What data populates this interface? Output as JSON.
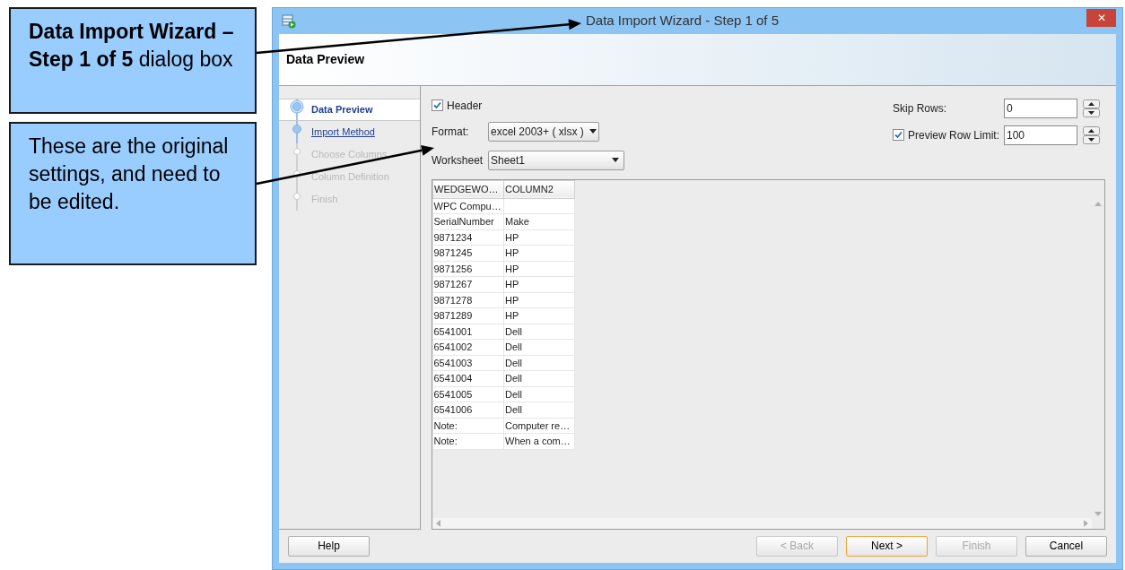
{
  "callouts": [
    {
      "text": "**Data Import Wizard – Step 1 of 5** dialog box"
    },
    {
      "text": "These are the original settings, and need to be edited."
    }
  ],
  "window": {
    "title": "Data Import Wizard - Step 1 of 5",
    "close": "✕"
  },
  "header": {
    "title": "Data Preview"
  },
  "steps": [
    {
      "label": "Data Preview",
      "kind": "current"
    },
    {
      "label": "Import Method",
      "kind": "link"
    },
    {
      "label": "Choose Columns",
      "kind": "disabled"
    },
    {
      "label": "Column Definition",
      "kind": "disabled"
    },
    {
      "label": "Finish",
      "kind": "disabled"
    }
  ],
  "header_option": {
    "label": "Header",
    "checked": true
  },
  "format": {
    "label": "Format:",
    "value": "excel 2003+ ( xlsx )"
  },
  "worksheet": {
    "label": "Worksheet",
    "value": "Sheet1"
  },
  "skip_rows": {
    "label": "Skip Rows:",
    "value": "0"
  },
  "preview_row_limit": {
    "label": "Preview Row Limit:",
    "checked": true,
    "value": "100"
  },
  "table": {
    "columns": [
      "WEDGEWO…",
      "COLUMN2"
    ],
    "rows": [
      [
        "WPC Compu…",
        ""
      ],
      [
        "SerialNumber",
        "Make"
      ],
      [
        "9871234",
        "HP"
      ],
      [
        "9871245",
        "HP"
      ],
      [
        "9871256",
        "HP"
      ],
      [
        "9871267",
        "HP"
      ],
      [
        "9871278",
        "HP"
      ],
      [
        "9871289",
        "HP"
      ],
      [
        "6541001",
        "Dell"
      ],
      [
        "6541002",
        "Dell"
      ],
      [
        "6541003",
        "Dell"
      ],
      [
        "6541004",
        "Dell"
      ],
      [
        "6541005",
        "Dell"
      ],
      [
        "6541006",
        "Dell"
      ],
      [
        "Note:",
        "Computer re…"
      ],
      [
        "Note:",
        "When a com…"
      ]
    ]
  },
  "buttons": [
    {
      "label": "Help",
      "disabled": false,
      "selected": false
    },
    {
      "label": "< Back",
      "disabled": true,
      "selected": false
    },
    {
      "label": "Next >",
      "disabled": false,
      "selected": true
    },
    {
      "label": "Finish",
      "disabled": true,
      "selected": false
    },
    {
      "label": "Cancel",
      "disabled": false,
      "selected": false
    }
  ]
}
